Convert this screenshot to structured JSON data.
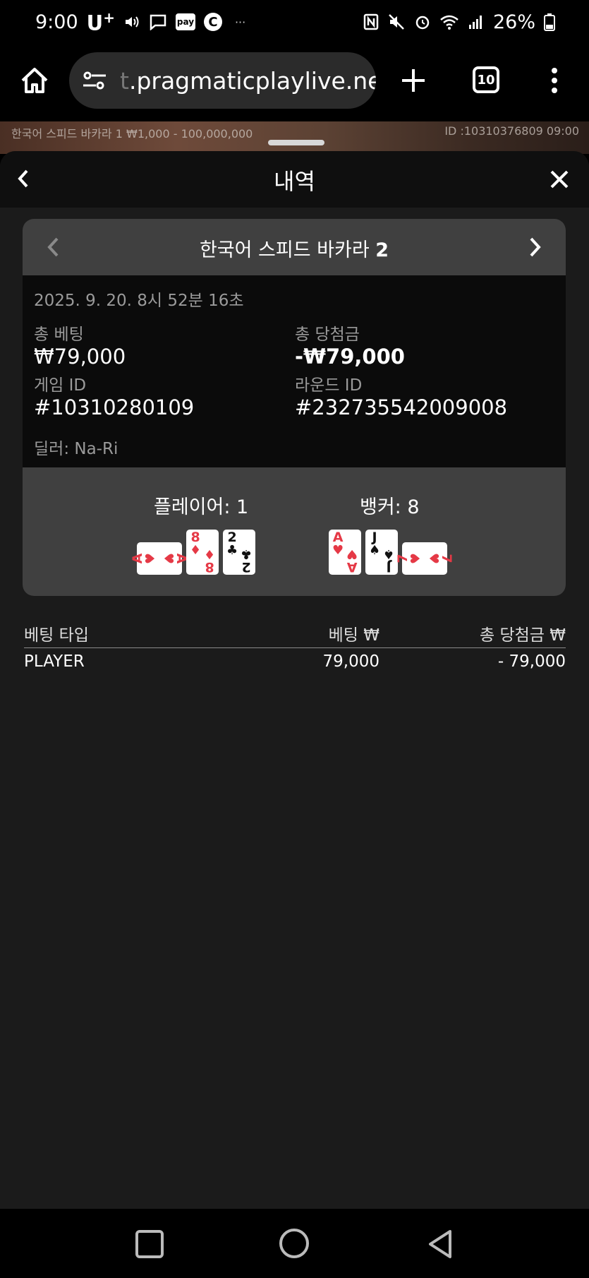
{
  "status_bar": {
    "time": "9:00",
    "carrier": "U",
    "carrier_sup": "+",
    "pay_label": "pay",
    "c_label": "C",
    "dots": "···",
    "battery": "26%"
  },
  "browser": {
    "url_faded": "t",
    "url": ".pragmaticplaylive.net",
    "tab_count": "10"
  },
  "game_strip": {
    "left_text": "한국어 스피드 바카라 1 ₩1,000 - 100,000,000",
    "right_text": "ID :10310376809 09:00"
  },
  "sheet": {
    "title": "내역"
  },
  "card": {
    "table_name": "한국어 스피드 바카라",
    "table_number": "2",
    "datetime": "2025. 9. 20. 8시 52분 16초",
    "total_bet_label": "총 베팅",
    "total_bet_value": "₩79,000",
    "total_win_label": "총 당첨금",
    "total_win_value": "-₩79,000",
    "game_id_label": "게임 ID",
    "game_id_value": "#10310280109",
    "round_id_label": "라운드 ID",
    "round_id_value": "#232735542009008",
    "dealer": "딜러: Na-Ri"
  },
  "result": {
    "player_label": "플레이어: 1",
    "banker_label": "뱅커: 8",
    "player_cards": [
      {
        "rank": "A",
        "suit": "♥",
        "color": "#e53946",
        "orientation": "horizontal"
      },
      {
        "rank": "8",
        "suit": "♦",
        "color": "#e53946",
        "orientation": "vertical"
      },
      {
        "rank": "2",
        "suit": "♣",
        "color": "#111111",
        "orientation": "vertical"
      }
    ],
    "banker_cards": [
      {
        "rank": "A",
        "suit": "♥",
        "color": "#e53946",
        "orientation": "vertical"
      },
      {
        "rank": "J",
        "suit": "♠",
        "color": "#111111",
        "orientation": "vertical"
      },
      {
        "rank": "7",
        "suit": "♥",
        "color": "#e53946",
        "orientation": "horizontal"
      }
    ]
  },
  "bets": {
    "headers": [
      "베팅 타입",
      "베팅 ₩",
      "총 당첨금 ₩"
    ],
    "rows": [
      {
        "type": "PLAYER",
        "bet": "79,000",
        "win": "- 79,000"
      }
    ]
  },
  "colors": {
    "sheet_bg": "#1b1b1b",
    "header_bg": "#404040",
    "card_red": "#e53946",
    "muted_text": "#9a9a9a"
  }
}
